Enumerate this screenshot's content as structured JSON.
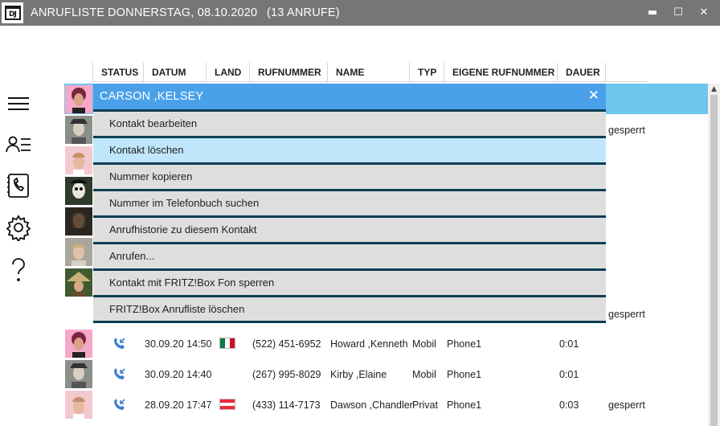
{
  "window": {
    "logo_text": "DJ",
    "app_title": "ANRUFLISTE",
    "day_title": "DONNERSTAG, 08.10.2020",
    "count_title": "(13 ANRUFE)",
    "minimize_label": "▬",
    "maximize_label": "☐",
    "close_label": "✕"
  },
  "nav": [
    {
      "icon": "hamburger-menu-icon"
    },
    {
      "icon": "contact-list-icon"
    },
    {
      "icon": "phonebook-icon"
    },
    {
      "icon": "gear-icon"
    },
    {
      "icon": "help-question-icon"
    }
  ],
  "columns": {
    "status": "STATUS",
    "datum": "DATUM",
    "land": "LAND",
    "rufnummer": "RUFNUMMER",
    "name": "NAME",
    "typ": "TYP",
    "eigene": "EIGENE RUFNUMMER",
    "dauer": "DAUER"
  },
  "context_menu": {
    "title": "CARSON ,KELSEY",
    "close": "✕",
    "items": [
      {
        "label": "Kontakt bearbeiten"
      },
      {
        "label": "Kontakt löschen"
      },
      {
        "label": "Nummer kopieren"
      },
      {
        "label": "Nummer im Telefonbuch suchen"
      },
      {
        "label": "Anrufhistorie zu diesem Kontakt"
      },
      {
        "label": "Anrufen..."
      },
      {
        "label": "Kontakt mit FRITZ!Box Fon sperren"
      },
      {
        "label": "FRITZ!Box Anrufliste löschen"
      }
    ]
  },
  "hidden_row_notes": [
    "gesperrt",
    "gesperrt"
  ],
  "rows": [
    {
      "datum": "30.09.20 14:50",
      "country": "Mexico",
      "rufnummer": "(522) 451-6952",
      "name": "Howard ,Kenneth",
      "typ": "Mobil",
      "eigene": "Phone1",
      "dauer": "0:01",
      "note": ""
    },
    {
      "datum": "30.09.20 14:40",
      "country": "",
      "rufnummer": "(267) 995-8029",
      "name": "Kirby ,Elaine",
      "typ": "Mobil",
      "eigene": "Phone1",
      "dauer": "0:01",
      "note": ""
    },
    {
      "datum": "28.09.20 17:47",
      "country": "Austria",
      "rufnummer": "(433) 114-7173",
      "name": "Dawson ,Chandler",
      "typ": "Privat",
      "eigene": "Phone1",
      "dauer": "0:03",
      "note": "gesperrt"
    }
  ],
  "colors": {
    "titlebar": "#767676",
    "selection": "#6ec6ee",
    "menu_header": "#4aa1ea",
    "menu_item": "#dedede",
    "menu_item_hover": "#bfe6fb",
    "menu_separator": "#0e3d55"
  }
}
